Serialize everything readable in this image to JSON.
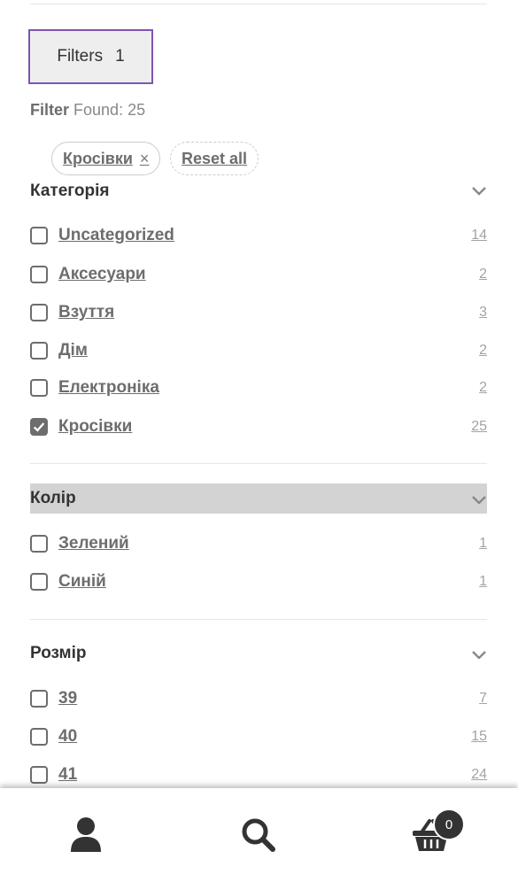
{
  "filters_button": {
    "label": "Filters",
    "count": "1"
  },
  "results": {
    "label": "Filter",
    "found": "Found: 25"
  },
  "active_filters": {
    "chip": "Кросівки",
    "remove": "×",
    "reset": "Reset all"
  },
  "sections": {
    "category": {
      "title": "Категорія",
      "items": [
        {
          "name": "Uncategorized",
          "count": "14",
          "checked": false
        },
        {
          "name": "Аксесуари",
          "count": "2",
          "checked": false
        },
        {
          "name": "Взуття",
          "count": "3",
          "checked": false
        },
        {
          "name": "Дім",
          "count": "2",
          "checked": false
        },
        {
          "name": "Електроніка",
          "count": "2",
          "checked": false
        },
        {
          "name": "Кросівки",
          "count": "25",
          "checked": true
        }
      ]
    },
    "color": {
      "title": "Колір",
      "items": [
        {
          "name": "Зелений",
          "count": "1",
          "checked": false
        },
        {
          "name": "Синій",
          "count": "1",
          "checked": false
        }
      ]
    },
    "size": {
      "title": "Розмір",
      "items": [
        {
          "name": "39",
          "count": "7",
          "checked": false
        },
        {
          "name": "40",
          "count": "15",
          "checked": false
        },
        {
          "name": "41",
          "count": "24",
          "checked": false
        }
      ]
    }
  },
  "bottom_nav": {
    "cart_count": "0"
  },
  "colors": {
    "accent": "#7f54b3",
    "text": "#333333",
    "muted": "#6d6d6d",
    "highlight": "#d3d3d3"
  }
}
